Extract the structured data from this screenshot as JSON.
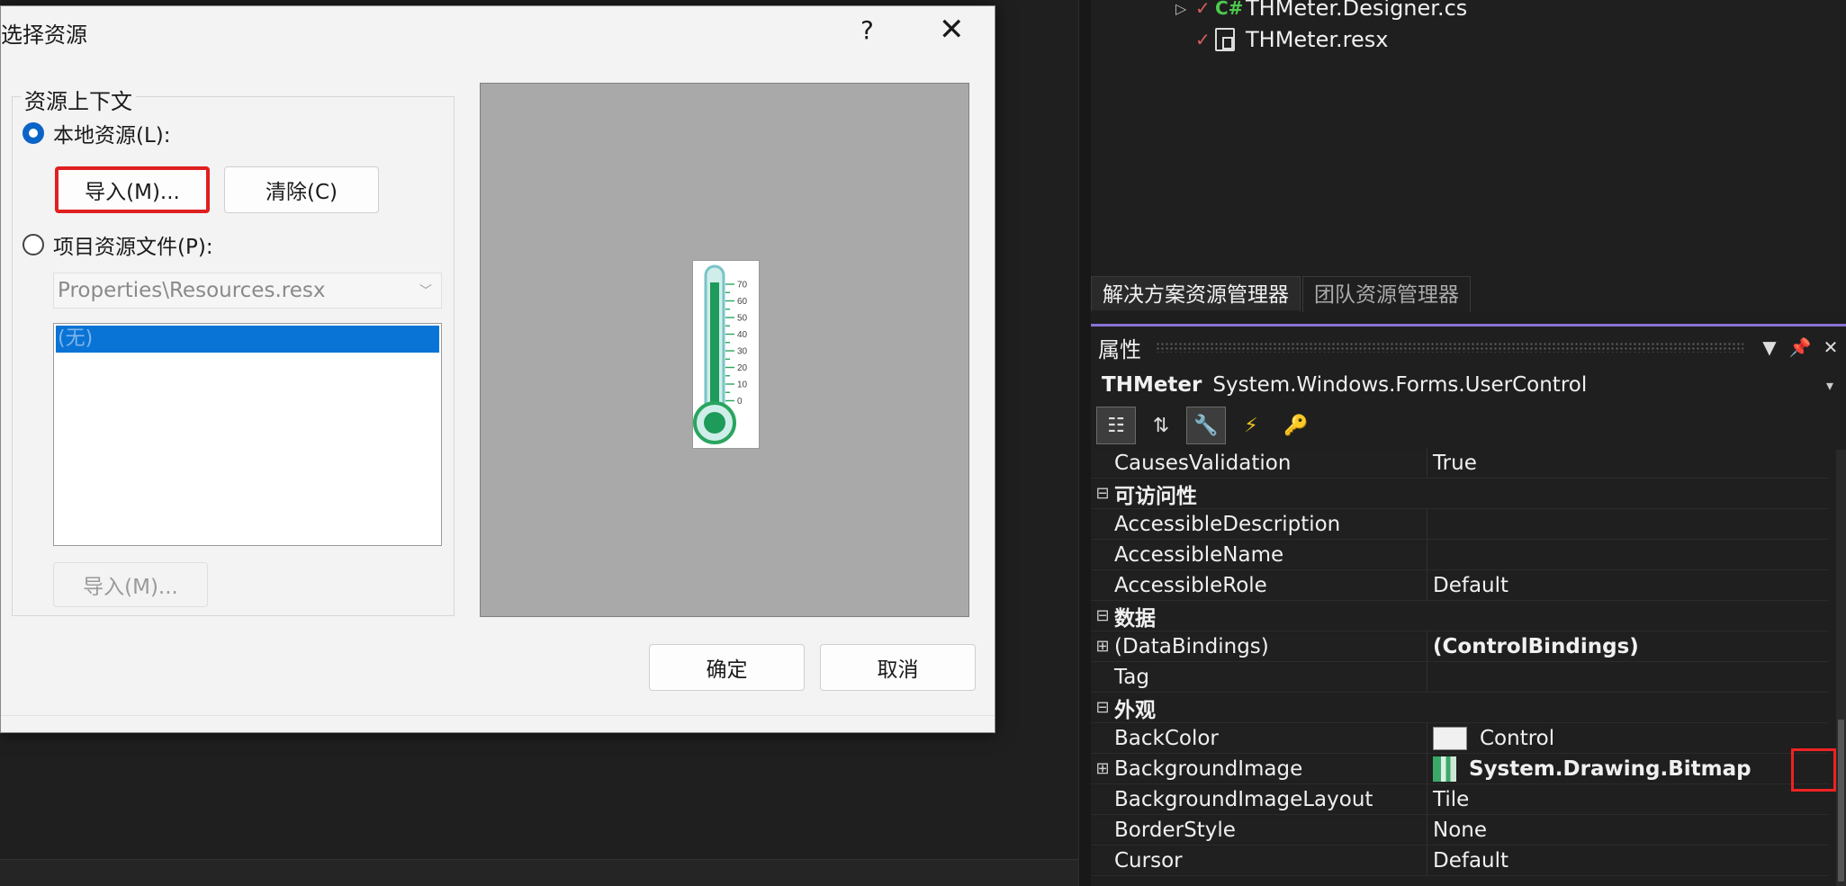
{
  "dialog": {
    "title": "选择资源",
    "help": "?",
    "close": "✕",
    "group_label": "资源上下文",
    "local_resource_label": "本地资源(L):",
    "import_button": "导入(M)...",
    "clear_button": "清除(C)",
    "project_resource_label": "项目资源文件(P):",
    "resource_file_value": "Properties\\Resources.resx",
    "list_items": [
      "(无)"
    ],
    "import_button_disabled": "导入(M)...",
    "ok_button": "确定",
    "cancel_button": "取消",
    "thermometer_scale": [
      "70",
      "60",
      "50",
      "40",
      "30",
      "20",
      "10",
      "0"
    ]
  },
  "solution_explorer": {
    "items": [
      {
        "label": "THMeter.Designer.cs",
        "icon": "csharp-file-icon",
        "lang": "C#"
      },
      {
        "label": "THMeter.resx",
        "icon": "resource-file-icon"
      }
    ],
    "tabs": [
      "解决方案资源管理器",
      "团队资源管理器"
    ]
  },
  "properties": {
    "title": "属性",
    "object_name": "THMeter",
    "object_type": "System.Windows.Forms.UserControl",
    "rows": [
      {
        "kind": "item",
        "name": "CausesValidation",
        "value": "True"
      },
      {
        "kind": "cat",
        "name": "可访问性"
      },
      {
        "kind": "item",
        "name": "AccessibleDescription",
        "value": ""
      },
      {
        "kind": "item",
        "name": "AccessibleName",
        "value": ""
      },
      {
        "kind": "item",
        "name": "AccessibleRole",
        "value": "Default"
      },
      {
        "kind": "cat",
        "name": "数据"
      },
      {
        "kind": "item",
        "name": "(DataBindings)",
        "value": "(ControlBindings)",
        "expandable": true,
        "bold": true
      },
      {
        "kind": "item",
        "name": "Tag",
        "value": ""
      },
      {
        "kind": "cat",
        "name": "外观"
      },
      {
        "kind": "item",
        "name": "BackColor",
        "value": "Control",
        "swatch": true
      },
      {
        "kind": "item",
        "name": "BackgroundImage",
        "value": "System.Drawing.Bitmap",
        "expandable": true,
        "bold": true,
        "bitmap": true
      },
      {
        "kind": "item",
        "name": "BackgroundImageLayout",
        "value": "Tile"
      },
      {
        "kind": "item",
        "name": "BorderStyle",
        "value": "None"
      },
      {
        "kind": "item",
        "name": "Cursor",
        "value": "Default"
      }
    ]
  },
  "colors": {
    "accent": "#0a64c8",
    "highlight_red": "#e02020",
    "selection_blue": "#0a74d6",
    "panel_accent": "#8a72d8"
  }
}
